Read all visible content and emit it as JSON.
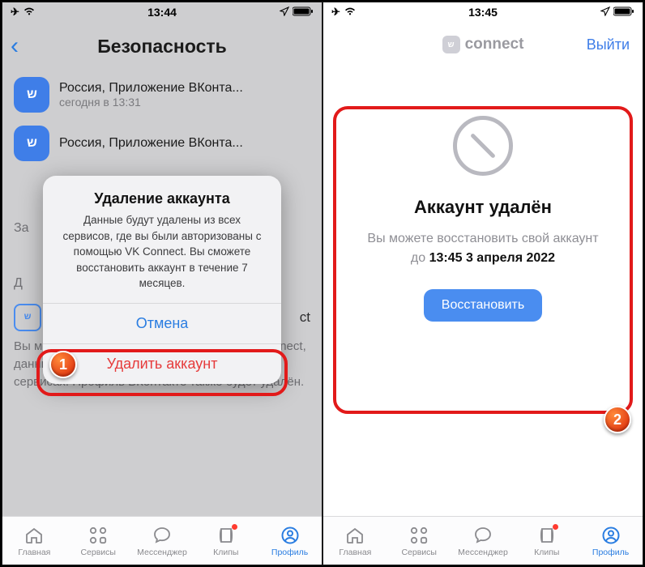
{
  "left": {
    "status_time": "13:44",
    "nav_title": "Безопасность",
    "sessions": [
      {
        "title": "Россия, Приложение ВКонта...",
        "sub": "сегодня в 13:31"
      },
      {
        "title": "Россия, Приложение ВКонта...",
        "sub": ""
      }
    ],
    "section_z": "За",
    "section_d": "Д",
    "connect_row_text": "ct",
    "connect_desc": "Вы можете полностью удалить аккаунт VK Connect, данные в нём и информацию о подключённых сервисах. Профиль ВКонтакте также будет удалён.",
    "dialog": {
      "title": "Удаление аккаунта",
      "message": "Данные будут удалены из всех сервисов, где вы были авторизованы с помощью VK Connect. Вы сможете восстановить аккаунт в течение 7 месяцев.",
      "cancel": "Отмена",
      "delete": "Удалить аккаунт"
    }
  },
  "right": {
    "status_time": "13:45",
    "brand": "connect",
    "logout": "Выйти",
    "deleted_title": "Аккаунт удалён",
    "deleted_msg_1": "Вы можете восстановить свой аккаунт",
    "deleted_msg_prefix": "до ",
    "deleted_deadline": "13:45 3 апреля 2022",
    "restore": "Восстановить"
  },
  "tabs": {
    "home": "Главная",
    "services": "Сервисы",
    "messenger": "Мессенджер",
    "clips": "Клипы",
    "profile": "Профиль"
  },
  "step1": "1",
  "step2": "2"
}
